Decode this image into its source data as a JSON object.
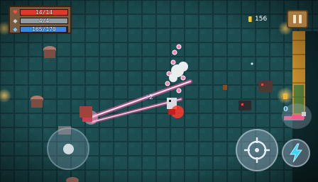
{
  "hud": {
    "health": {
      "text": "14/14",
      "current": 14,
      "max": 14,
      "color": "#e0392b",
      "icon": "heart-icon"
    },
    "armor": {
      "text": "4/4",
      "current": 4,
      "max": 4,
      "color": "#8f9aa3",
      "icon": "shield-icon"
    },
    "energy": {
      "text": "165/170",
      "current": 165,
      "max": 170,
      "color": "#3b86d9",
      "icon": "energy-diamond-icon"
    },
    "coins": {
      "value": "156",
      "icon": "coin-icon"
    },
    "weapon": {
      "energy_cost": "0",
      "icon": "weapon-icon"
    },
    "pause": {
      "icon": "pause-icon"
    },
    "attack": {
      "icon": "crosshair-icon"
    },
    "skill": {
      "icon": "lightning-icon"
    }
  },
  "palette": {
    "floor": "#1c4e52",
    "wall": "#123438",
    "laser": "#ff5fa8",
    "torch": "#ffcf4a",
    "skill_bolt": "#3fd4ff"
  }
}
